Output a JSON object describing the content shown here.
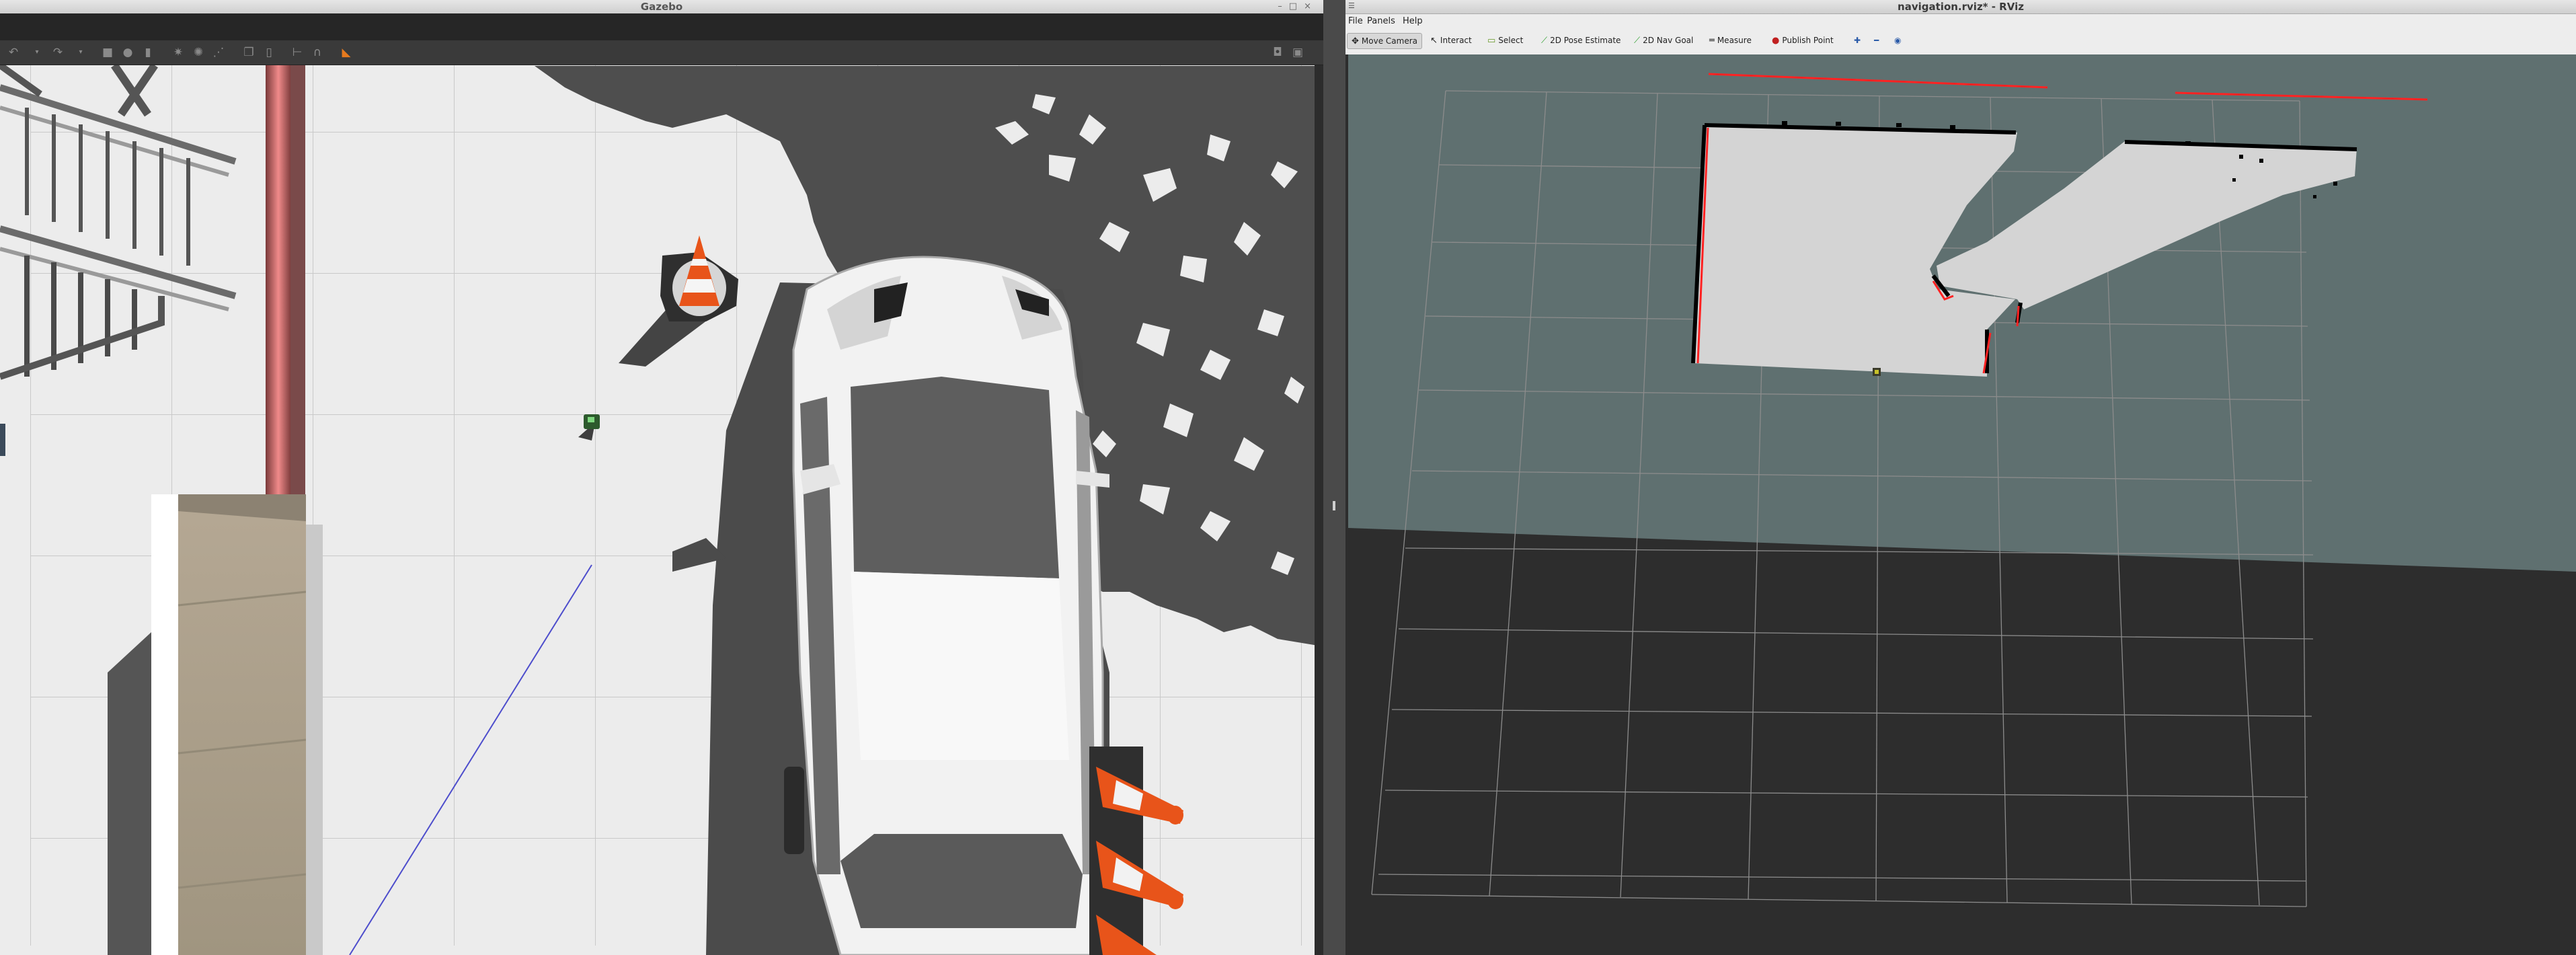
{
  "gazebo": {
    "title": "Gazebo",
    "toolbar_icons": [
      "undo-icon",
      "undo-dropdown-icon",
      "redo-icon",
      "redo-dropdown-icon",
      "box-icon",
      "sphere-icon",
      "cylinder-icon",
      "sun-icon",
      "spot-light-icon",
      "directional-light-icon",
      "copy-icon",
      "paste-icon",
      "align-icon",
      "snap-icon",
      "orange-view-icon",
      "screenshot-icon",
      "record-icon"
    ]
  },
  "rviz": {
    "title": "navigation.rviz* - RViz",
    "menu": {
      "file": "File",
      "panels": "Panels",
      "help": "Help"
    },
    "tools": {
      "move_camera": "Move Camera",
      "interact": "Interact",
      "select": "Select",
      "pose_estimate": "2D Pose Estimate",
      "nav_goal": "2D Nav Goal",
      "measure": "Measure",
      "publish_point": "Publish Point"
    }
  },
  "colors": {
    "gazebo_ground": "#ececec",
    "gazebo_shadow": "#4f4f4f",
    "rviz_background": "#2d2d2d",
    "map_unknown": "#5f7070",
    "map_free": "#d4d4d4",
    "map_occupied": "#000000",
    "laser_scan": "#ff2222",
    "cone_orange": "#e8541a"
  }
}
